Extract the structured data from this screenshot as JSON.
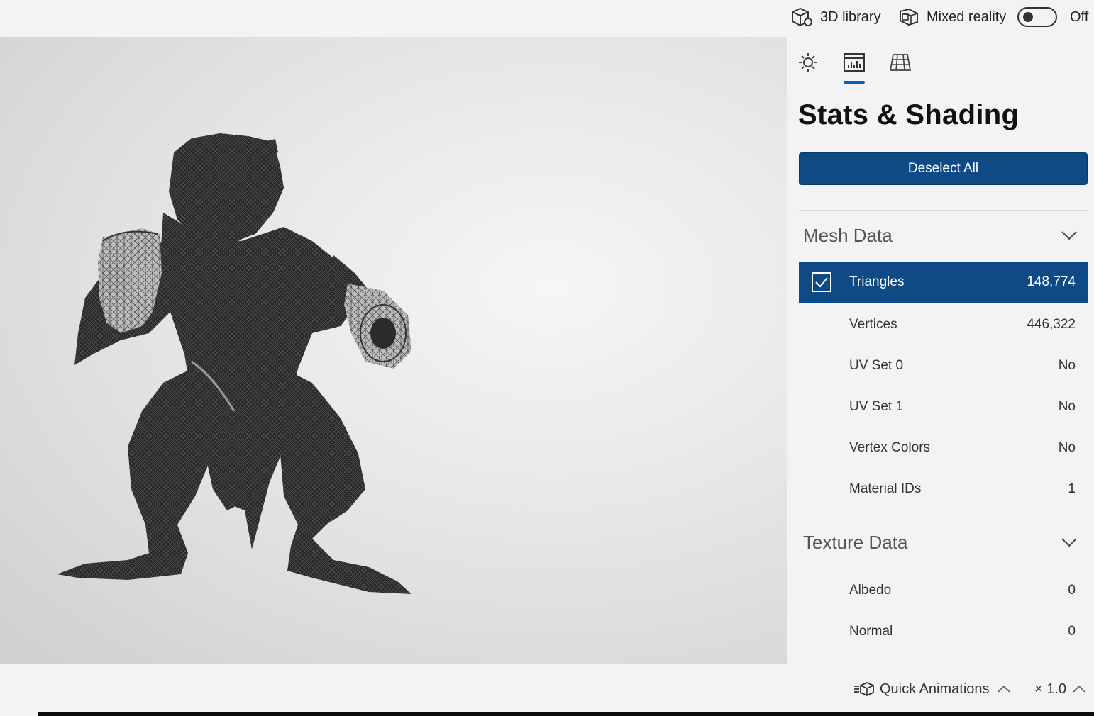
{
  "topbar": {
    "library_icon": "cube-icon",
    "library_label": "3D library",
    "mr_icon": "mixed-reality-icon",
    "mr_label": "Mixed reality",
    "mr_toggle_state": "Off"
  },
  "panel": {
    "tabs": [
      {
        "name": "lighting",
        "icon": "sun-icon",
        "selected": false
      },
      {
        "name": "stats",
        "icon": "stats-chart-icon",
        "selected": true
      },
      {
        "name": "grid",
        "icon": "grid-icon",
        "selected": false
      }
    ],
    "title": "Stats & Shading",
    "deselect_label": "Deselect All",
    "mesh_section": {
      "title": "Mesh Data",
      "rows": [
        {
          "label": "Triangles",
          "value": "148,774",
          "checked": true
        },
        {
          "label": "Vertices",
          "value": "446,322"
        },
        {
          "label": "UV Set 0",
          "value": "No"
        },
        {
          "label": "UV Set 1",
          "value": "No"
        },
        {
          "label": "Vertex Colors",
          "value": "No"
        },
        {
          "label": "Material IDs",
          "value": "1"
        }
      ]
    },
    "texture_section": {
      "title": "Texture Data",
      "rows": [
        {
          "label": "Albedo",
          "value": "0"
        },
        {
          "label": "Normal",
          "value": "0"
        }
      ]
    }
  },
  "bottombar": {
    "animations_icon": "animation-icon",
    "animations_label": "Quick Animations",
    "speed_label": "× 1.0"
  },
  "colors": {
    "accent": "#0d4a86",
    "tab_indicator": "#0a5fb5",
    "background": "#f3f3f3"
  }
}
